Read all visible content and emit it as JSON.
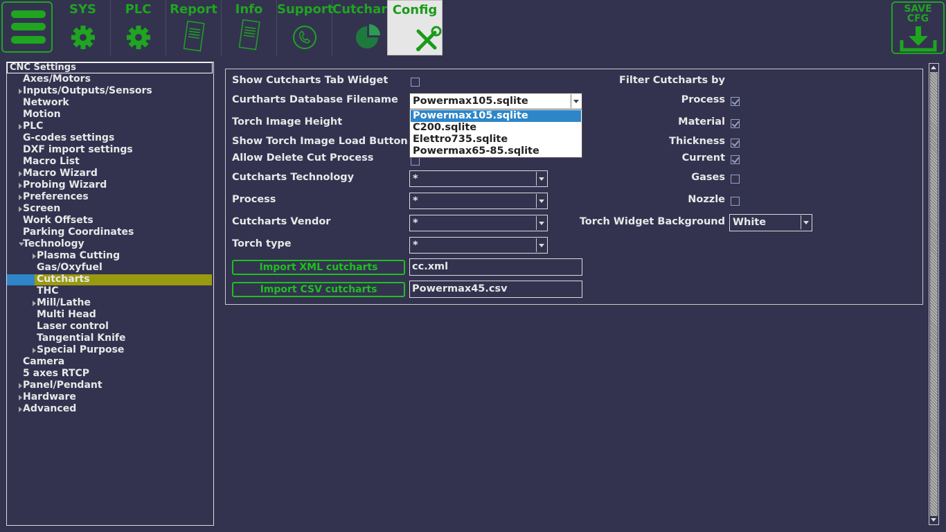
{
  "toolbar": {
    "tabs": [
      {
        "label": "SYS"
      },
      {
        "label": "PLC"
      },
      {
        "label": "Report"
      },
      {
        "label": "Info"
      },
      {
        "label": "Support"
      },
      {
        "label": "Cutchart"
      },
      {
        "label": "Config"
      }
    ],
    "save_label_line1": "SAVE",
    "save_label_line2": "CFG",
    "accent": "#1fa51f"
  },
  "tree": {
    "header": "CNC Settings",
    "items": [
      {
        "label": "Axes/Motors"
      },
      {
        "label": "Inputs/Outputs/Sensors"
      },
      {
        "label": "Network"
      },
      {
        "label": "Motion"
      },
      {
        "label": "PLC"
      },
      {
        "label": "G-codes settings"
      },
      {
        "label": "DXF import settings"
      },
      {
        "label": "Macro List"
      },
      {
        "label": "Macro Wizard"
      },
      {
        "label": "Probing Wizard"
      },
      {
        "label": "Preferences"
      },
      {
        "label": "Screen"
      },
      {
        "label": "Work Offsets"
      },
      {
        "label": "Parking Coordinates"
      },
      {
        "label": "Technology"
      },
      {
        "label": "Plasma Cutting"
      },
      {
        "label": "Gas/Oxyfuel"
      },
      {
        "label": "Cutcharts"
      },
      {
        "label": "THC"
      },
      {
        "label": "Mill/Lathe"
      },
      {
        "label": "Multi Head"
      },
      {
        "label": "Laser control"
      },
      {
        "label": "Tangential Knife"
      },
      {
        "label": "Special Purpose"
      },
      {
        "label": "Camera"
      },
      {
        "label": "5 axes RTCP"
      },
      {
        "label": "Panel/Pendant"
      },
      {
        "label": "Hardware"
      },
      {
        "label": "Advanced"
      }
    ]
  },
  "form": {
    "show_tab_widget": "Show Cutcharts Tab Widget",
    "db_filename": "Curtharts Database Filename",
    "db_value": "Powermax105.sqlite",
    "db_options": [
      "Powermax105.sqlite",
      "C200.sqlite",
      "Elettro735.sqlite",
      "Powermax65-85.sqlite"
    ],
    "torch_image_height": "Torch Image Height",
    "show_torch_load": "Show Torch Image Load Button",
    "allow_delete": "Allow Delete Cut Process",
    "technology": "Cutcharts Technology",
    "technology_value": "*",
    "process": "Process",
    "process_value": "*",
    "vendor": "Cutcharts Vendor",
    "vendor_value": "*",
    "torch_type": "Torch type",
    "torch_type_value": "*",
    "import_xml": "Import XML cutcharts",
    "xml_file": "cc.xml",
    "import_csv": "Import CSV cutcharts",
    "csv_file": "Powermax45.csv",
    "filter_title": "Filter Cutcharts by",
    "filter_process": "Process",
    "filter_material": "Material",
    "filter_thickness": "Thickness",
    "filter_current": "Current",
    "filter_gases": "Gases",
    "filter_nozzle": "Nozzle",
    "torch_bg": "Torch Widget Background",
    "torch_bg_value": "White"
  }
}
